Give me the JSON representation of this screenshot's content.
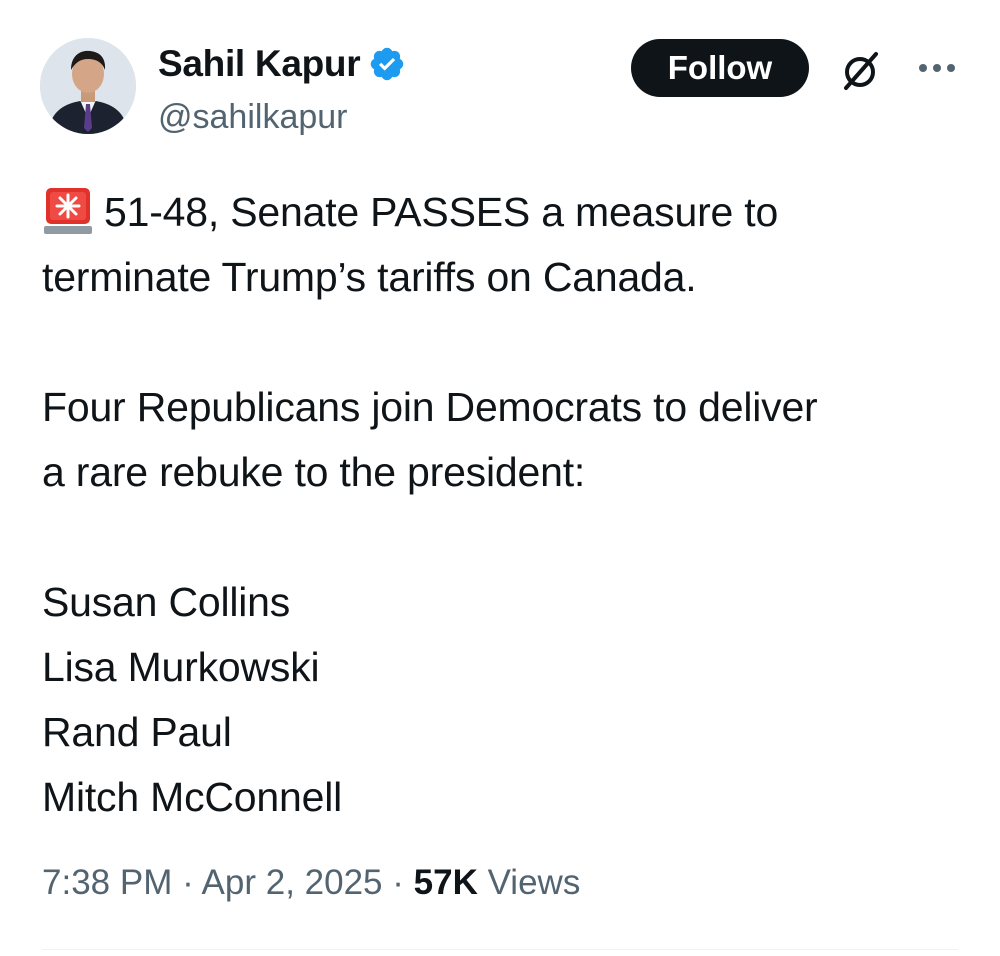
{
  "author": {
    "name": "Sahil Kapur",
    "handle": "@sahilkapur",
    "verified_icon": "verified-badge-icon",
    "verified_color": "#1d9bf0"
  },
  "actions": {
    "follow_label": "Follow",
    "grok_icon": "grok-icon",
    "more_icon": "more-options-icon"
  },
  "tweet": {
    "emoji": "rotating-light-siren",
    "line1": "51-48, Senate PASSES a measure to",
    "line2": "terminate Trump’s tariffs on Canada.",
    "line3": "Four Republicans join Democrats to deliver",
    "line4": "a rare rebuke to the president:",
    "senators": [
      "Susan Collins",
      "Lisa Murkowski",
      "Rand Paul",
      "Mitch McConnell"
    ]
  },
  "meta": {
    "time": "7:38 PM",
    "separator": "·",
    "date": "Apr 2, 2025",
    "views_count": "57K",
    "views_label": "Views"
  },
  "colors": {
    "text": "#0f1419",
    "secondary": "#536471",
    "button_bg": "#0f1419",
    "siren_red": "#e0312b"
  }
}
